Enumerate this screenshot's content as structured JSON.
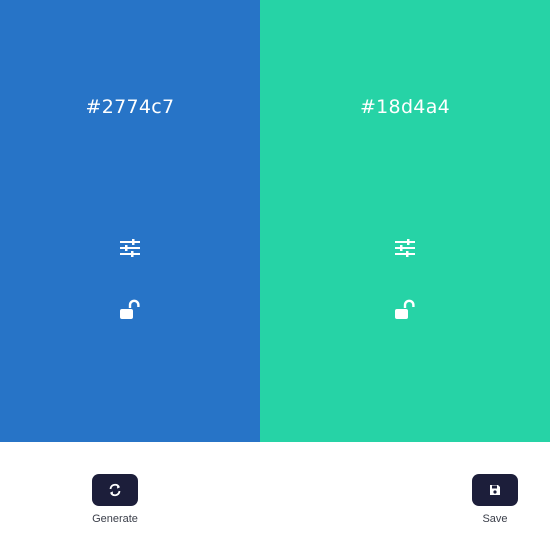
{
  "swatches": [
    {
      "hex_label": "#2774c7",
      "color": "#2774c7",
      "adjust_icon": "sliders-icon",
      "lock_icon": "unlock-icon"
    },
    {
      "hex_label": "#18d4a4",
      "color": "#26d3a6",
      "adjust_icon": "sliders-icon",
      "lock_icon": "unlock-icon"
    }
  ],
  "actions": {
    "generate_label": "Generate",
    "generate_icon": "refresh-icon",
    "save_label": "Save",
    "save_icon": "save-icon",
    "button_color": "#1c1e3a"
  }
}
